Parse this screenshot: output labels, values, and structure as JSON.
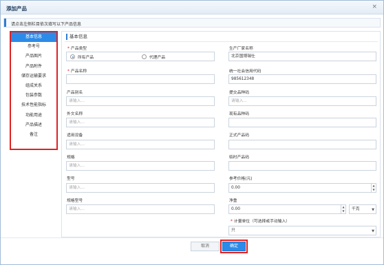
{
  "dialog": {
    "title": "添加产品",
    "close_glyph": "×"
  },
  "hint": "请点击左侧栏目依次填写以下产品信息",
  "sidebar": {
    "items": [
      {
        "label": "基本信息",
        "active": true
      },
      {
        "label": "参考号"
      },
      {
        "label": "产品图片"
      },
      {
        "label": "产品附件"
      },
      {
        "label": "储存运输要求"
      },
      {
        "label": "组成关系"
      },
      {
        "label": "包装参数"
      },
      {
        "label": "技术性能指标"
      },
      {
        "label": "功能用途"
      },
      {
        "label": "产品描述"
      },
      {
        "label": "备注"
      }
    ]
  },
  "section": {
    "title": "基本信息"
  },
  "left": {
    "product_type": {
      "label": "产品类型",
      "options": [
        "所有产品",
        "代理产品"
      ],
      "selected": "所有产品"
    },
    "product_name": {
      "label": "产品名称",
      "value": ""
    },
    "product_alias": {
      "label": "产品别名",
      "placeholder": "请输入..."
    },
    "foreign_name": {
      "label": "外文名称",
      "placeholder": "请输入..."
    },
    "applicable_device": {
      "label": "适用设备",
      "placeholder": "请输入..."
    },
    "spec": {
      "label": "规格",
      "placeholder": "请输入..."
    },
    "model": {
      "label": "型号",
      "placeholder": "请输入..."
    },
    "spec_model": {
      "label": "规格型号",
      "placeholder": "请输入..."
    }
  },
  "right": {
    "manufacturer": {
      "label": "生产厂家名称",
      "value": "北京国博瑞仕"
    },
    "credit_code": {
      "label": "统一社会信用代码",
      "value": "985612348"
    },
    "report_code": {
      "label": "提交品种码",
      "placeholder": "请输入..."
    },
    "existing_code": {
      "label": "现有品种码",
      "value": ""
    },
    "formal_code": {
      "label": "正式产品码",
      "value": ""
    },
    "temp_code": {
      "label": "临时产品码",
      "value": ""
    },
    "ref_price": {
      "label": "参考价格(元)",
      "value": "0.00"
    },
    "net_weight": {
      "label": "净重",
      "value": "0.00",
      "unit": "千克"
    },
    "unit": {
      "label": "计量单位（可选择或手动输入）",
      "value": "只"
    }
  },
  "buttons": {
    "cancel": "取消",
    "confirm": "确定"
  },
  "colors": {
    "accent": "#2c8be8",
    "highlight": "#e02020"
  }
}
